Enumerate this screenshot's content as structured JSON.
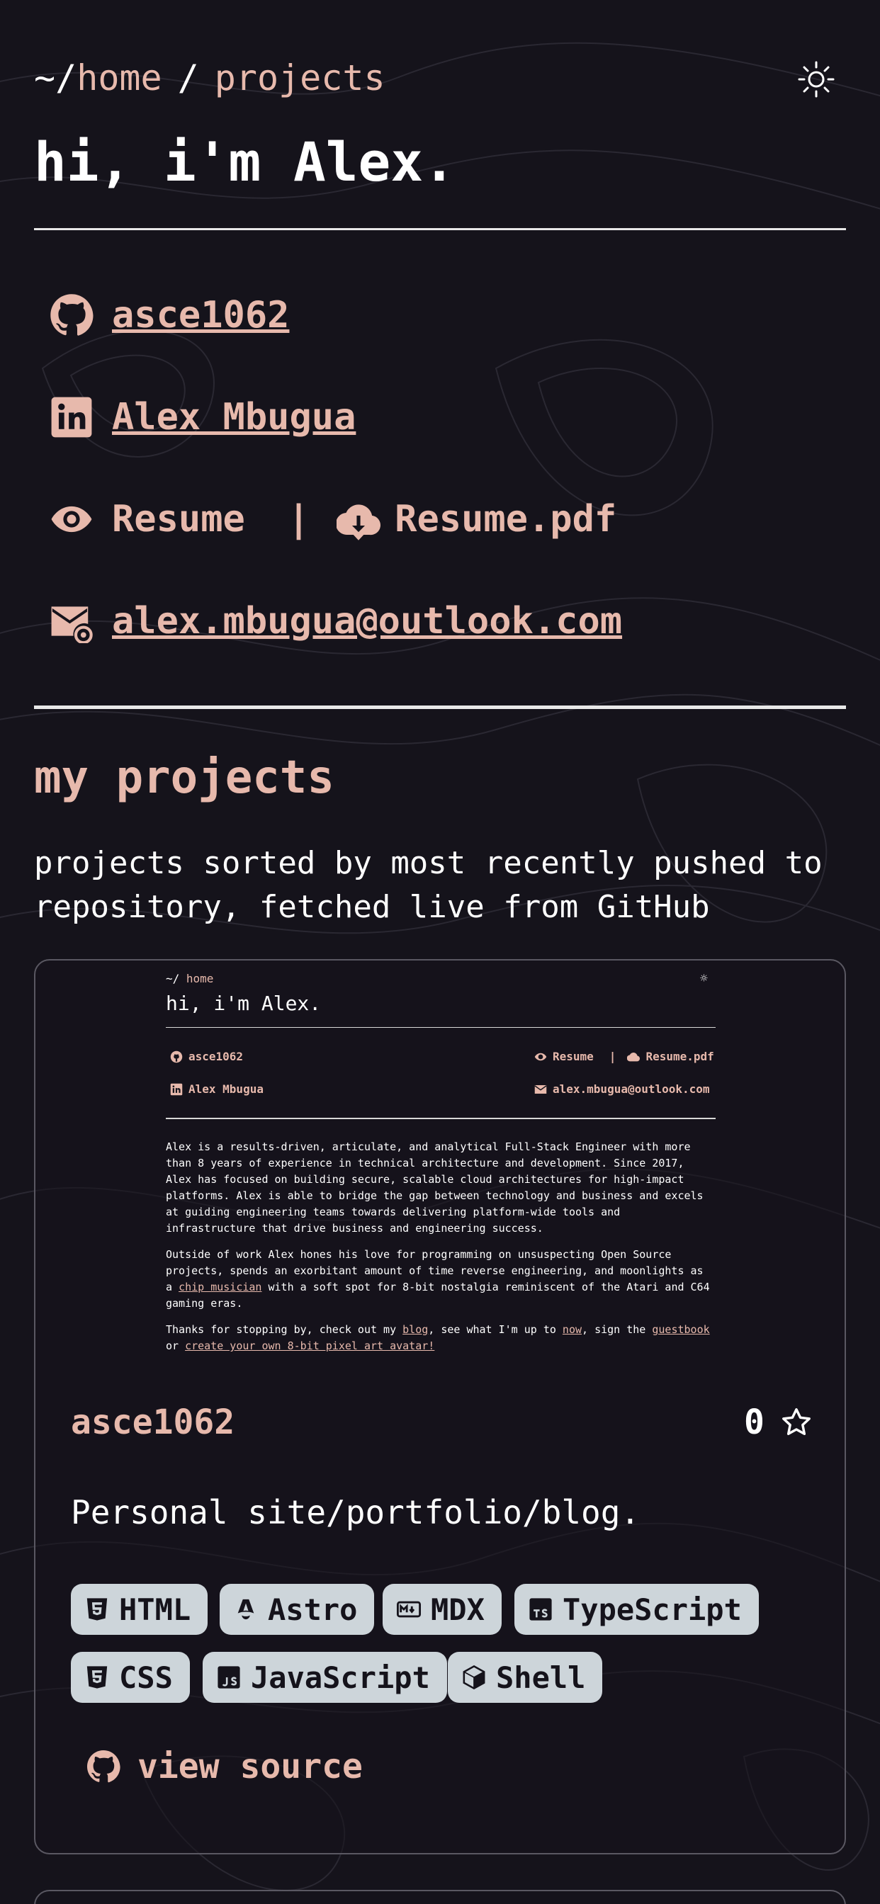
{
  "header": {
    "crumb_root": "~/",
    "crumb_home": "home",
    "crumb_sep": "/",
    "crumb_current": "projects",
    "greeting": "hi, i'm Alex.",
    "theme_icon": "sun-icon"
  },
  "contacts": {
    "github": "asce1062",
    "linkedin": "Alex Mbugua",
    "resume": "Resume",
    "divider": "|",
    "resume_pdf": "Resume.pdf",
    "email": "alex.mbugua@outlook.com"
  },
  "section": {
    "title": "my projects",
    "description": "projects sorted by most recently pushed to repository, fetched live from GitHub"
  },
  "projects": [
    {
      "preview": {
        "crumb_root": "~/",
        "crumb_home": "home",
        "sun": "☼",
        "greeting": "hi, i'm Alex.",
        "github": "asce1062",
        "linkedin": "Alex Mbugua",
        "resume": "Resume",
        "divider": "|",
        "resume_pdf": "Resume.pdf",
        "email": "alex.mbugua@outlook.com",
        "para1": "Alex is a results-driven, articulate, and analytical Full-Stack Engineer with more than 8 years of experience in technical architecture and development. Since 2017, Alex has focused on building secure, scalable cloud architectures for high-impact platforms. Alex is able to bridge the gap between technology and business and excels at guiding engineering teams towards delivering platform-wide tools and infrastructure that drive business and engineering success.",
        "para2_a": "Outside of work Alex hones his love for programming on unsuspecting Open Source projects, spends an exorbitant amount of time reverse engineering, and moonlights as a ",
        "para2_link": "chip musician",
        "para2_b": " with a soft spot for 8-bit nostalgia reminiscent of the Atari and C64 gaming eras.",
        "para3_a": "Thanks for stopping by, check out my ",
        "para3_blog": "blog",
        "para3_b": ", see what I'm up to ",
        "para3_now": "now",
        "para3_c": ", sign the ",
        "para3_guestbook": "guestbook",
        "para3_d": " or ",
        "para3_avatar": "create your own 8-bit pixel art avatar!"
      },
      "name": "asce1062",
      "stars": "0",
      "description": "Personal site/portfolio/blog.",
      "tags": [
        {
          "label": "HTML",
          "icon": "html5-icon"
        },
        {
          "label": "Astro",
          "icon": "astro-icon"
        },
        {
          "label": "MDX",
          "icon": "mdx-icon"
        },
        {
          "label": "TypeScript",
          "icon": "typescript-icon"
        },
        {
          "label": "CSS",
          "icon": "css3-icon"
        },
        {
          "label": "JavaScript",
          "icon": "javascript-icon"
        },
        {
          "label": "Shell",
          "icon": "shell-icon"
        }
      ],
      "view_source": "view source"
    }
  ],
  "colors": {
    "background": "#15131b",
    "accent": "#e7b9ac",
    "tag_bg": "#cdd5da",
    "border": "#5a5862"
  }
}
